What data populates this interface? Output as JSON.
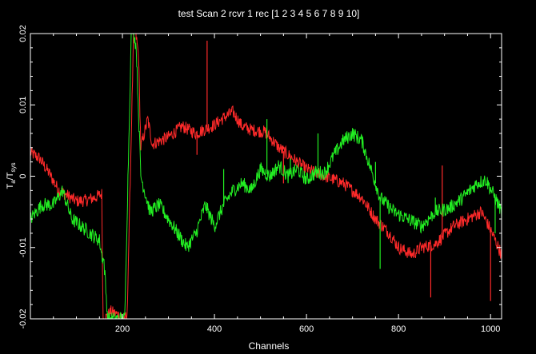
{
  "chart_data": {
    "type": "line",
    "title": "test  Scan 2  rcvr 1  rec [1 2 3 4 5 6 7 8 9 10]",
    "xlabel": "Channels",
    "ylabel_main": "T",
    "ylabel_sub1": "a",
    "ylabel_mid": "/T",
    "ylabel_sub2": "sys",
    "xlim": [
      0,
      1024
    ],
    "ylim": [
      -0.02,
      0.02
    ],
    "x_ticks": [
      200,
      400,
      600,
      800,
      1000
    ],
    "y_ticks": [
      -0.02,
      -0.01,
      0,
      0.01,
      0.02
    ],
    "y_tick_labels": [
      "-0.02",
      "-0.01",
      "0",
      "0.01",
      "0.02"
    ],
    "x_tick_labels": [
      "200",
      "400",
      "600",
      "800",
      "1000"
    ],
    "grid": false,
    "background": "#000000",
    "axis_color": "#ffffff",
    "series": [
      {
        "color": "#ff2a2a",
        "noise": 0.0009,
        "points": [
          [
            0,
            0.0033
          ],
          [
            20,
            0.0025
          ],
          [
            40,
            0.0005
          ],
          [
            60,
            -0.0018
          ],
          [
            80,
            -0.0027
          ],
          [
            100,
            -0.0035
          ],
          [
            120,
            -0.0034
          ],
          [
            140,
            -0.003
          ],
          [
            155,
            -0.0025
          ],
          [
            158,
            -0.02
          ],
          [
            162,
            -0.02
          ],
          [
            175,
            -0.019
          ],
          [
            210,
            -0.02
          ],
          [
            225,
            0.022
          ],
          [
            235,
            0.017
          ],
          [
            240,
            0.004
          ],
          [
            255,
            0.008
          ],
          [
            265,
            0.0045
          ],
          [
            300,
            0.0055
          ],
          [
            330,
            0.007
          ],
          [
            360,
            0.006
          ],
          [
            400,
            0.0072
          ],
          [
            420,
            0.0082
          ],
          [
            440,
            0.009
          ],
          [
            460,
            0.007
          ],
          [
            480,
            0.0065
          ],
          [
            510,
            0.0062
          ],
          [
            540,
            0.004
          ],
          [
            560,
            0.003
          ],
          [
            600,
            0.001
          ],
          [
            640,
            0.0
          ],
          [
            680,
            -0.001
          ],
          [
            700,
            -0.002
          ],
          [
            720,
            -0.003
          ],
          [
            750,
            -0.006
          ],
          [
            780,
            -0.008
          ],
          [
            800,
            -0.01
          ],
          [
            830,
            -0.011
          ],
          [
            850,
            -0.01
          ],
          [
            880,
            -0.0095
          ],
          [
            920,
            -0.007
          ],
          [
            950,
            -0.006
          ],
          [
            980,
            -0.005
          ],
          [
            1000,
            -0.0075
          ],
          [
            1024,
            -0.011
          ]
        ],
        "spikes": [
          [
            362,
            0.003
          ],
          [
            384,
            0.019
          ],
          [
            512,
            0.0055
          ],
          [
            550,
            -0.001
          ],
          [
            870,
            -0.017
          ],
          [
            895,
            0.0015
          ],
          [
            1000,
            -0.0175
          ]
        ]
      },
      {
        "color": "#22ee22",
        "noise": 0.001,
        "points": [
          [
            0,
            -0.006
          ],
          [
            25,
            -0.004
          ],
          [
            50,
            -0.004
          ],
          [
            70,
            -0.002
          ],
          [
            90,
            -0.006
          ],
          [
            110,
            -0.007
          ],
          [
            130,
            -0.008
          ],
          [
            150,
            -0.009
          ],
          [
            155,
            -0.011
          ],
          [
            160,
            -0.012
          ],
          [
            168,
            -0.02
          ],
          [
            180,
            -0.02
          ],
          [
            205,
            -0.02
          ],
          [
            220,
            0.022
          ],
          [
            230,
            0.018
          ],
          [
            240,
            0.0
          ],
          [
            260,
            -0.005
          ],
          [
            280,
            -0.004
          ],
          [
            300,
            -0.006
          ],
          [
            320,
            -0.008
          ],
          [
            340,
            -0.01
          ],
          [
            360,
            -0.008
          ],
          [
            380,
            -0.004
          ],
          [
            400,
            -0.007
          ],
          [
            420,
            -0.004
          ],
          [
            440,
            -0.002
          ],
          [
            460,
            -0.001
          ],
          [
            480,
            -0.002
          ],
          [
            500,
            0.001
          ],
          [
            520,
            0.0
          ],
          [
            540,
            0.0015
          ],
          [
            560,
            0.0
          ],
          [
            580,
            0.001
          ],
          [
            600,
            -0.0005
          ],
          [
            620,
            0.0005
          ],
          [
            640,
            0.0005
          ],
          [
            660,
            0.003
          ],
          [
            680,
            0.005
          ],
          [
            700,
            0.006
          ],
          [
            720,
            0.005
          ],
          [
            740,
            0.001
          ],
          [
            760,
            -0.003
          ],
          [
            790,
            -0.005
          ],
          [
            820,
            -0.006
          ],
          [
            850,
            -0.007
          ],
          [
            880,
            -0.005
          ],
          [
            910,
            -0.0045
          ],
          [
            940,
            -0.003
          ],
          [
            970,
            -0.001
          ],
          [
            990,
            -0.0005
          ],
          [
            1010,
            -0.003
          ],
          [
            1024,
            -0.005
          ]
        ],
        "spikes": [
          [
            420,
            0.001
          ],
          [
            514,
            0.008
          ],
          [
            565,
            0.0025
          ],
          [
            625,
            0.006
          ],
          [
            750,
            0.002
          ],
          [
            760,
            -0.013
          ],
          [
            880,
            -0.003
          ],
          [
            1010,
            -0.008
          ]
        ]
      }
    ]
  }
}
